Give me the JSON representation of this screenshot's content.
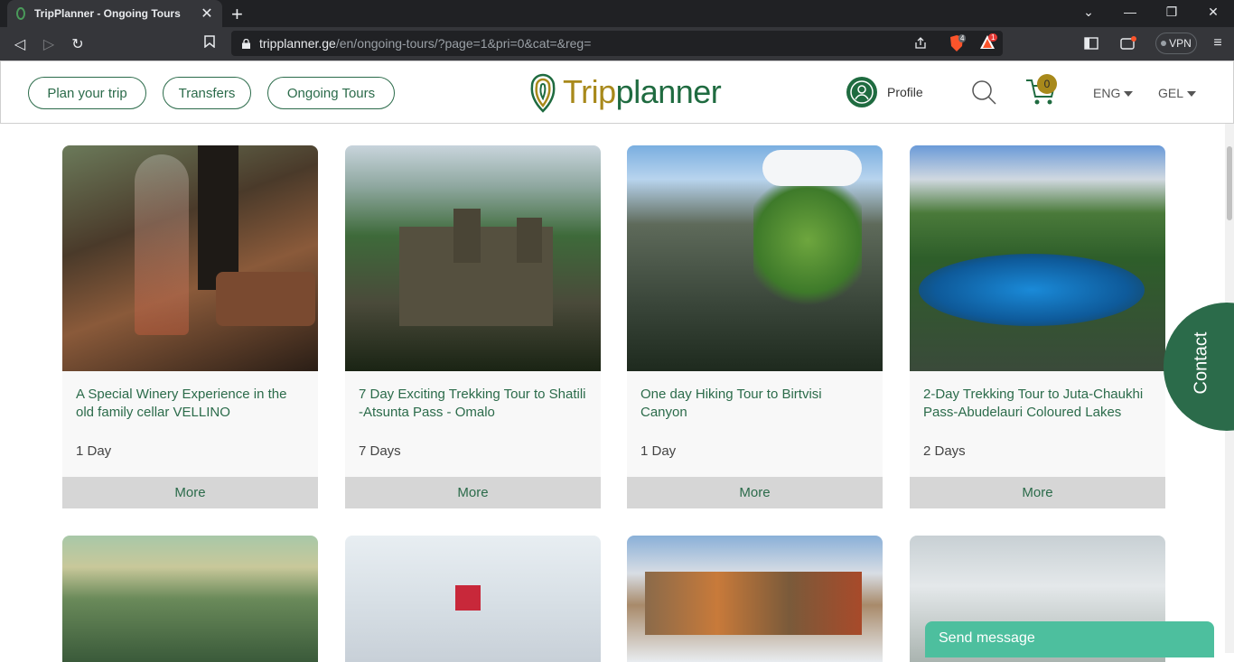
{
  "browser": {
    "tab_title": "TripPlanner - Ongoing Tours",
    "url_host": "tripplanner.ge",
    "url_path": "/en/ongoing-tours/?page=1&pri=0&cat=&reg=",
    "brave_count": "4",
    "alert_count": "1",
    "vpn_label": "VPN"
  },
  "header": {
    "nav": [
      {
        "label": "Plan your trip"
      },
      {
        "label": "Transfers"
      },
      {
        "label": "Ongoing Tours"
      }
    ],
    "logo_prefix": "Trip",
    "logo_suffix": "planner",
    "profile_label": "Profile",
    "cart_count": "0",
    "language": "ENG",
    "currency": "GEL"
  },
  "tours": [
    {
      "title": "A Special Winery Experience in the old family cellar VELLINO",
      "duration": "1 Day",
      "more": "More"
    },
    {
      "title": "7 Day Exciting Trekking Tour to Shatili -Atsunta Pass - Omalo",
      "duration": "7 Days",
      "more": "More"
    },
    {
      "title": "One day Hiking Tour to Birtvisi Canyon",
      "duration": "1 Day",
      "more": "More"
    },
    {
      "title": "2-Day Trekking Tour to Juta-Chaukhi Pass-Abudelauri Coloured Lakes",
      "duration": "2 Days",
      "more": "More"
    }
  ],
  "widgets": {
    "contact_label": "Contact",
    "send_message_label": "Send message"
  },
  "colors": {
    "brand_green": "#2b6b4a",
    "brand_gold": "#a8891b",
    "chat_teal": "#4dbf9e"
  }
}
